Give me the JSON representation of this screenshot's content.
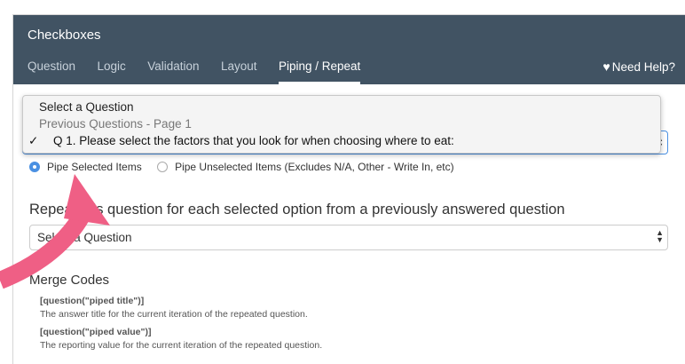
{
  "header": {
    "title": "Checkboxes",
    "tabs": [
      "Question",
      "Logic",
      "Validation",
      "Layout",
      "Piping / Repeat"
    ],
    "active_tab": "Piping / Repeat",
    "help_label": "Need Help?"
  },
  "dropdown": {
    "placeholder": "Select a Question",
    "group_label": "Previous Questions - Page 1",
    "selected_option": "Q 1. Please select the factors that you look for when choosing where to eat:",
    "check_mark": "✓"
  },
  "pipe_options": {
    "selected": "Pipe Selected Items",
    "unselected": "Pipe Unselected Items (Excludes N/A, Other - Write In, etc)"
  },
  "repeat": {
    "heading": "Repeat this question for each selected option from a previously answered question",
    "select_value": "Select a Question"
  },
  "merge_codes": {
    "title": "Merge Codes",
    "items": [
      {
        "code": "[question(\"piped title\")]",
        "desc": "The answer title for the current iteration of the repeated question."
      },
      {
        "code": "[question(\"piped value\")]",
        "desc": "The reporting value for the current iteration of the repeated question."
      }
    ]
  },
  "colors": {
    "header_bg": "#415363",
    "accent": "#4a90e2",
    "annotation_arrow": "#ef5f85"
  }
}
